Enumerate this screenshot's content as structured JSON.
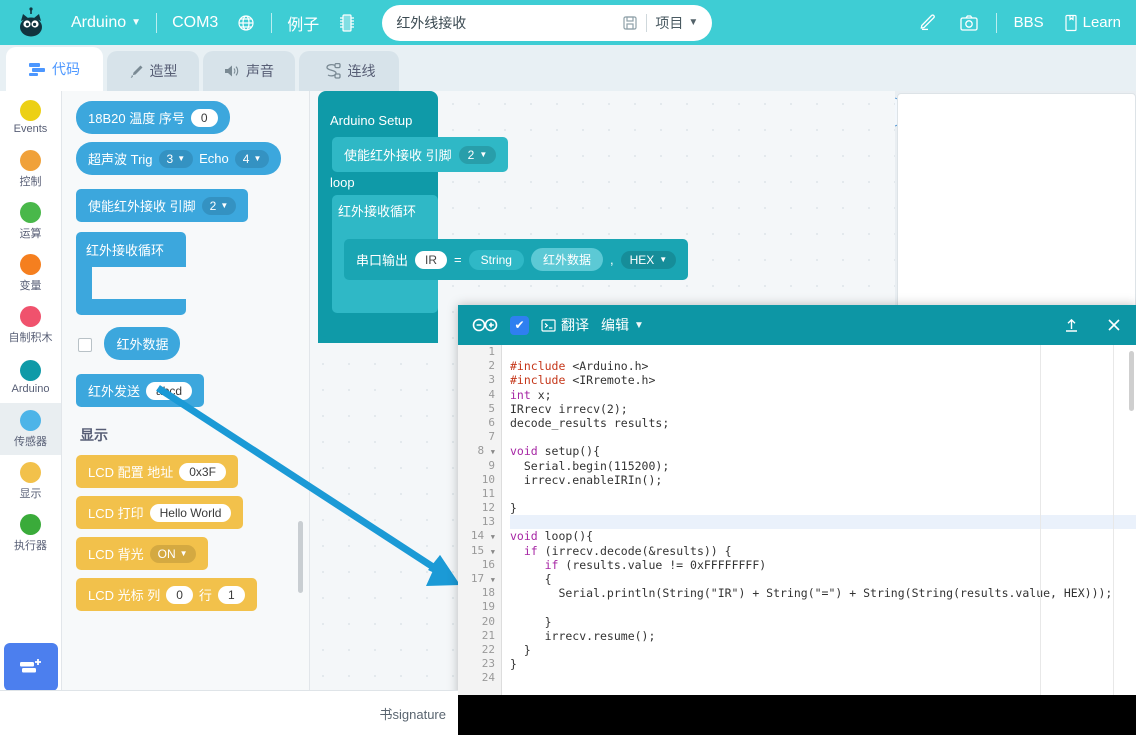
{
  "topbar": {
    "platform": "Arduino",
    "port": "COM3",
    "examples": "例子",
    "project_name": "红外线接收",
    "project_menu": "项目",
    "bbs": "BBS",
    "learn": "Learn",
    "icons": {
      "logo": "cat-logo-icon",
      "globe": "globe-icon",
      "chip": "chip-icon",
      "save": "save-icon",
      "pen": "pen-icon",
      "camera": "camera-icon",
      "book": "book-icon"
    }
  },
  "tabs": [
    {
      "label": "代码",
      "icon": "blocks-icon",
      "active": true
    },
    {
      "label": "造型",
      "icon": "brush-icon",
      "active": false
    },
    {
      "label": "声音",
      "icon": "speaker-icon",
      "active": false
    },
    {
      "label": "连线",
      "icon": "wire-icon",
      "active": false
    }
  ],
  "toolbar": {
    "undo": "undo-icon",
    "redo": "redo-icon",
    "help": "?",
    "green_flag": "green-flag-icon",
    "stop": "stop-icon"
  },
  "sidebar": {
    "items": [
      {
        "label": "Events",
        "color": "#ecd014"
      },
      {
        "label": "控制",
        "color": "#f0a13a"
      },
      {
        "label": "运算",
        "color": "#49b84a"
      },
      {
        "label": "变量",
        "color": "#f57f1f"
      },
      {
        "label": "自制积木",
        "color": "#f0526d"
      },
      {
        "label": "Arduino",
        "color": "#0f9aa8"
      },
      {
        "label": "传感器",
        "color": "#4db4e8"
      },
      {
        "label": "显示",
        "color": "#f2c14b"
      },
      {
        "label": "执行器",
        "color": "#3aab3a"
      }
    ],
    "selected": "传感器",
    "extension_button": "add-extension-icon"
  },
  "palette": {
    "blocks": [
      {
        "id": "ds18b20",
        "type": "reporter",
        "color": "blue",
        "parts": [
          {
            "t": "label",
            "v": "18B20 温度 序号"
          },
          {
            "t": "white",
            "v": "0"
          }
        ]
      },
      {
        "id": "ultrasonic",
        "type": "reporter",
        "color": "blue",
        "parts": [
          {
            "t": "label",
            "v": "超声波 Trig"
          },
          {
            "t": "drop",
            "v": "3"
          },
          {
            "t": "label",
            "v": "Echo"
          },
          {
            "t": "drop",
            "v": "4"
          }
        ]
      },
      {
        "id": "ir-enable",
        "type": "stack",
        "color": "blue",
        "parts": [
          {
            "t": "label",
            "v": "使能红外接收 引脚"
          },
          {
            "t": "drop",
            "v": "2"
          }
        ]
      },
      {
        "id": "ir-loop",
        "type": "c-block",
        "color": "blue",
        "parts": [
          {
            "t": "label",
            "v": "红外接收循环"
          }
        ]
      },
      {
        "id": "ir-data",
        "type": "reporter-check",
        "color": "blue",
        "parts": [
          {
            "t": "label",
            "v": "红外数据"
          }
        ]
      },
      {
        "id": "ir-send",
        "type": "stack",
        "color": "blue",
        "parts": [
          {
            "t": "label",
            "v": "红外发送"
          },
          {
            "t": "white",
            "v": "abcd"
          }
        ]
      }
    ],
    "section_heading": "显示",
    "display_blocks": [
      {
        "id": "lcd-config",
        "color": "yellow",
        "parts": [
          {
            "t": "label",
            "v": "LCD 配置 地址"
          },
          {
            "t": "white",
            "v": "0x3F"
          }
        ]
      },
      {
        "id": "lcd-print",
        "color": "yellow",
        "parts": [
          {
            "t": "label",
            "v": "LCD 打印"
          },
          {
            "t": "white",
            "v": "Hello World"
          }
        ]
      },
      {
        "id": "lcd-backlight",
        "color": "yellow",
        "parts": [
          {
            "t": "label",
            "v": "LCD 背光"
          },
          {
            "t": "drop",
            "v": "ON"
          }
        ]
      },
      {
        "id": "lcd-cursor",
        "color": "yellow",
        "parts": [
          {
            "t": "label",
            "v": "LCD 光标 列"
          },
          {
            "t": "white",
            "v": "0"
          },
          {
            "t": "label",
            "v": "行"
          },
          {
            "t": "white",
            "v": "1"
          }
        ]
      }
    ]
  },
  "workspace": {
    "setup_hat": "Arduino Setup",
    "setup_block": {
      "label": "使能红外接收 引脚",
      "pin": "2"
    },
    "loop_hat": "loop",
    "loop_block": "红外接收循环",
    "serial_block": {
      "label": "串口输出",
      "key": "IR",
      "eq": "=",
      "fn": "String",
      "value": "红外数据",
      "comma": ",",
      "format": "HEX"
    }
  },
  "code_panel": {
    "title_icon": "arduino-infinity-icon",
    "verify_icon": "check-icon",
    "translate": "翻译",
    "translate_icon": "terminal-icon",
    "edit": "编辑",
    "upload_icon": "upload-icon",
    "close_icon": "close-icon",
    "highlight_line": 13,
    "fold_lines": [
      8,
      14,
      15,
      17
    ],
    "lines": [
      {
        "n": 1,
        "text": ""
      },
      {
        "n": 2,
        "text": "#include <Arduino.h>"
      },
      {
        "n": 3,
        "text": "#include <IRremote.h>"
      },
      {
        "n": 4,
        "text": "int x;"
      },
      {
        "n": 5,
        "text": "IRrecv irrecv(2);"
      },
      {
        "n": 6,
        "text": "decode_results results;"
      },
      {
        "n": 7,
        "text": ""
      },
      {
        "n": 8,
        "text": "void setup(){"
      },
      {
        "n": 9,
        "text": "  Serial.begin(115200);"
      },
      {
        "n": 10,
        "text": "  irrecv.enableIRIn();"
      },
      {
        "n": 11,
        "text": ""
      },
      {
        "n": 12,
        "text": "}"
      },
      {
        "n": 13,
        "text": ""
      },
      {
        "n": 14,
        "text": "void loop(){"
      },
      {
        "n": 15,
        "text": "  if (irrecv.decode(&results)) {"
      },
      {
        "n": 16,
        "text": "     if (results.value != 0xFFFFFFFF)"
      },
      {
        "n": 17,
        "text": "     {"
      },
      {
        "n": 18,
        "text": "       Serial.println(String(\"IR\") + String(\"=\") + String(String(results.value, HEX)));"
      },
      {
        "n": 19,
        "text": ""
      },
      {
        "n": 20,
        "text": "     }"
      },
      {
        "n": 21,
        "text": "     irrecv.resume();"
      },
      {
        "n": 22,
        "text": "  }"
      },
      {
        "n": 23,
        "text": "}"
      },
      {
        "n": 24,
        "text": ""
      }
    ]
  },
  "bottom_bar": {
    "text": "书signature"
  },
  "annotation": {
    "type": "arrow",
    "color": "#1b9ad6",
    "from": "红外数据",
    "to": "code-line-18"
  }
}
